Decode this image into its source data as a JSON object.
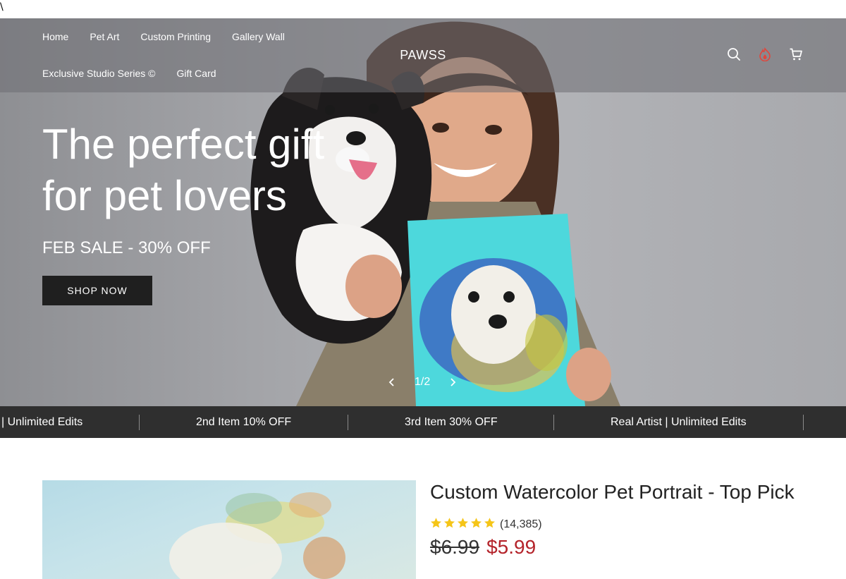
{
  "stray_char": "\\",
  "brand": {
    "logo": "PAWSS"
  },
  "nav": {
    "items": [
      "Home",
      "Pet Art",
      "Custom Printing",
      "Gallery Wall",
      "Exclusive Studio Series ©",
      "Gift Card"
    ]
  },
  "header_icons": [
    "search-icon",
    "loyalty-flame-icon",
    "cart-icon"
  ],
  "hero": {
    "title_line1": "The perfect gift",
    "title_line2": "for pet lovers",
    "subtitle": "FEB SALE - 30% OFF",
    "cta": "SHOP NOW",
    "slide_indicator": "1/2"
  },
  "marquee": {
    "items": [
      "| Unlimited Edits",
      "2nd Item 10% OFF",
      "3rd Item 30% OFF",
      "Real Artist | Unlimited Edits"
    ]
  },
  "product": {
    "title": "Custom Watercolor Pet Portrait - Top Pick",
    "rating": 5,
    "rating_count": "(14,385)",
    "old_price": "$6.99",
    "new_price": "$5.99"
  },
  "colors": {
    "marquee_bg": "#2f2f2f",
    "cta_bg": "#1f1f1f",
    "sale_price": "#b4232a",
    "star": "#f5c518",
    "flame_icon": "#e0463c"
  }
}
